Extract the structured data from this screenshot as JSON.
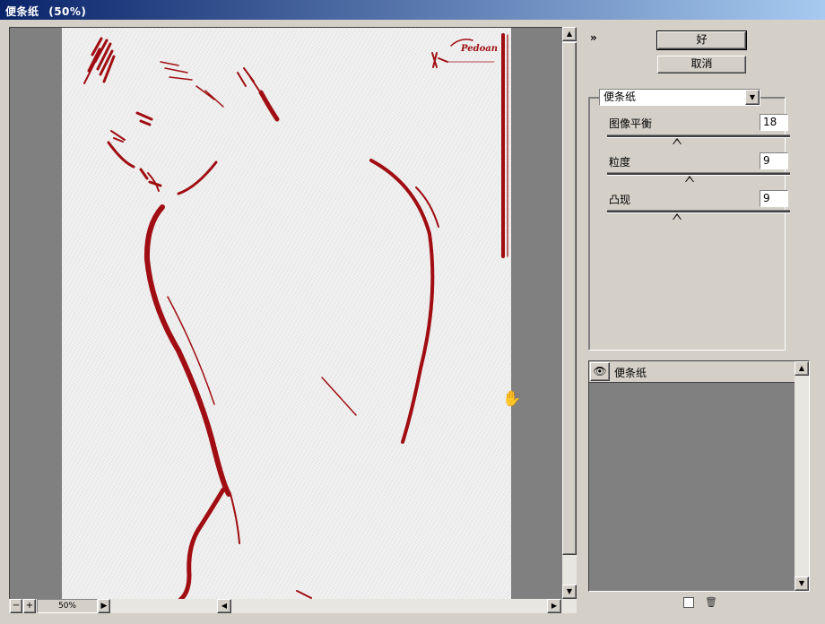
{
  "window": {
    "title": "便条纸",
    "zoom_title": "(50%)"
  },
  "preview": {
    "watermark": "Pedoan",
    "zoom_value": "50%",
    "zoom_minus": "−",
    "zoom_plus": "+"
  },
  "buttons": {
    "ok": "好",
    "cancel": "取消"
  },
  "filter": {
    "selected": "便条纸",
    "params": [
      {
        "label": "图像平衡",
        "value": "18",
        "fraction": 0.38
      },
      {
        "label": "粒度",
        "value": "9",
        "fraction": 0.45
      },
      {
        "label": "凸现",
        "value": "9",
        "fraction": 0.38
      }
    ]
  },
  "layers": {
    "items": [
      {
        "name": "便条纸",
        "visible": true
      }
    ]
  },
  "colors": {
    "accent_red": "#a00d12",
    "title_start": "#0a246a",
    "title_end": "#a6caf0",
    "panel": "#d4d0c8"
  },
  "icons": [
    "eye-icon",
    "hand-cursor-icon",
    "new-layer-icon",
    "trash-icon",
    "double-chevron-icon"
  ]
}
